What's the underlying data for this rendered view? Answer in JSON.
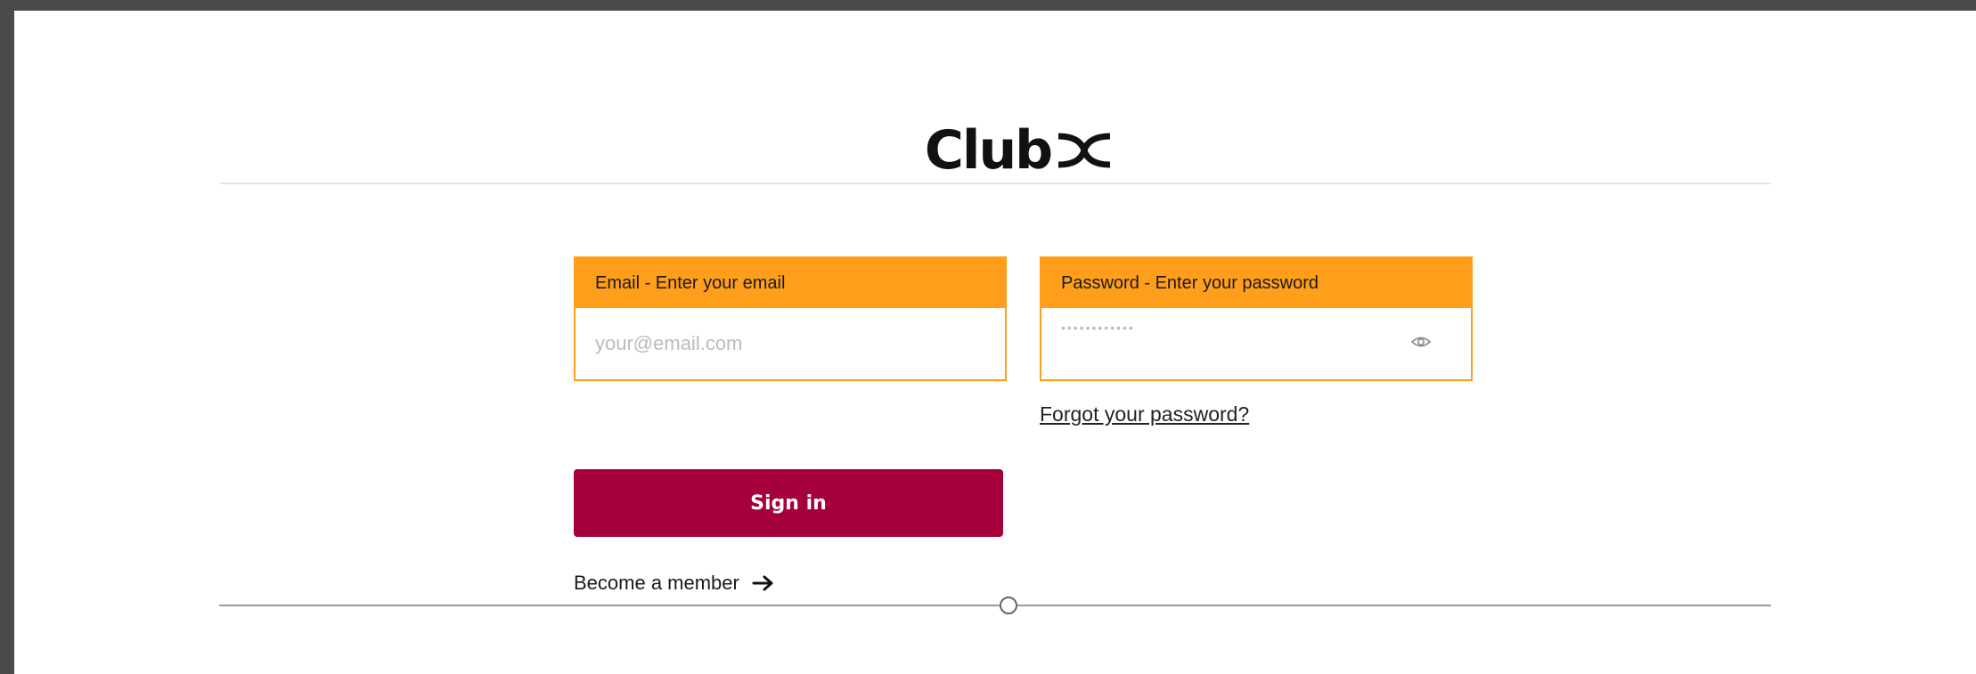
{
  "brand": {
    "name": "Club",
    "mark": "≤",
    "colors": {
      "accent": "#ff9e1b",
      "primary_button": "#a5003b",
      "text": "#1a1a1a"
    }
  },
  "login_form": {
    "email": {
      "label": "Email - Enter your email",
      "placeholder": "your@email.com",
      "value": ""
    },
    "password": {
      "label": "Password - Enter your password",
      "placeholder": "••••••••••••",
      "value": "",
      "toggle_icon": "eye-icon"
    },
    "forgot_password": "Forgot your password?",
    "sign_in": "Sign in",
    "become_member": "Become a member",
    "become_member_icon": "arrow-right-icon"
  }
}
